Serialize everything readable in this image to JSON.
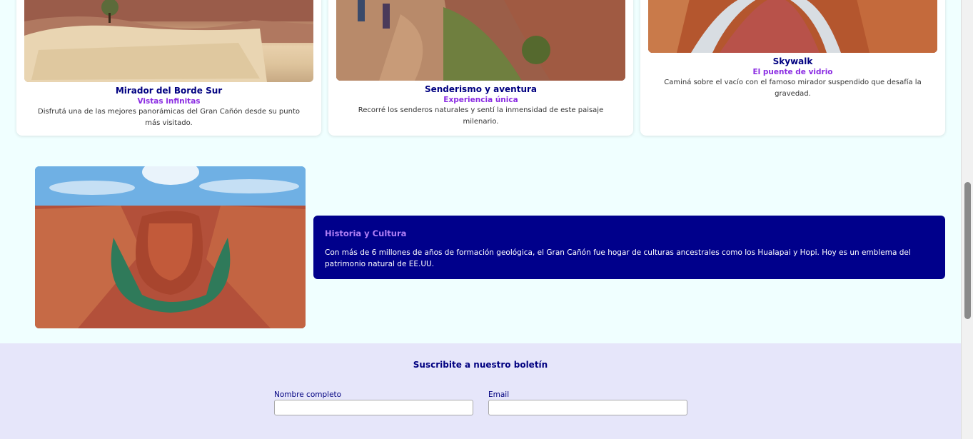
{
  "cards": [
    {
      "image": "grand-canyon-south-rim-overlook",
      "title": "Mirador del Borde Sur",
      "subtitle": "Vistas infinitas",
      "description": "Disfrutá una de las mejores panorámicas del Gran Cañón desde su punto más visitado."
    },
    {
      "image": "hikers-on-canyon-trail",
      "title": "Senderismo y aventura",
      "subtitle": "Experiencia única",
      "description": "Recorré los senderos naturales y sentí la inmensidad de este paisaje milenario."
    },
    {
      "image": "glass-skywalk-bridge",
      "title": "Skywalk",
      "subtitle": "El puente de vidrio",
      "description": "Caminá sobre el vacío con el famoso mirador suspendido que desafía la gravedad."
    }
  ],
  "history": {
    "image": "horseshoe-bend-canyon",
    "title": "Historia y Cultura",
    "text": "Con más de 6 millones de años de formación geológica, el Gran Cañón fue hogar de culturas ancestrales como los Hualapai y Hopi. Hoy es un emblema del patrimonio natural de EE.UU."
  },
  "newsletter": {
    "title": "Suscribite a nuestro boletín",
    "fields": [
      {
        "label": "Nombre completo",
        "value": ""
      },
      {
        "label": "Email",
        "value": ""
      }
    ]
  },
  "colors": {
    "page_bg": "#f0ffff",
    "accent_navy": "#000080",
    "accent_purple": "#8a2be2",
    "history_bg": "#00008b",
    "newsletter_bg": "#e6e6fa"
  }
}
